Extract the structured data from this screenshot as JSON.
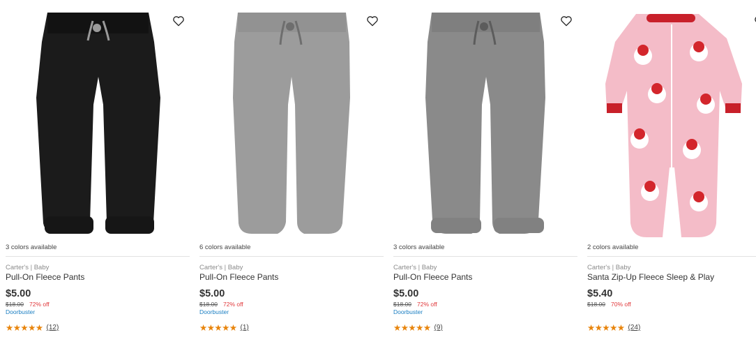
{
  "products": [
    {
      "colors": "3 colors available",
      "brand": "Carter's | Baby",
      "name": "Pull-On Fleece Pants",
      "price": "$5.00",
      "original_price": "$18.00",
      "discount": "72% off",
      "badge": "Doorbuster",
      "stars": "★★★★★",
      "review_count": "(12)",
      "image": "black-fleece-pants",
      "image_color": "#1b1b1b"
    },
    {
      "colors": "6 colors available",
      "brand": "Carter's | Baby",
      "name": "Pull-On Fleece Pants",
      "price": "$5.00",
      "original_price": "$18.00",
      "discount": "72% off",
      "badge": "Doorbuster",
      "stars": "★★★★★",
      "review_count": "(1)",
      "image": "light-gray-fleece-pants",
      "image_color": "#9c9c9c"
    },
    {
      "colors": "3 colors available",
      "brand": "Carter's | Baby",
      "name": "Pull-On Fleece Pants",
      "price": "$5.00",
      "original_price": "$18.00",
      "discount": "72% off",
      "badge": "Doorbuster",
      "stars": "★★★★★",
      "review_count": "(9)",
      "image": "gray-fleece-pants",
      "image_color": "#8a8a8a"
    },
    {
      "colors": "2 colors available",
      "brand": "Carter's | Baby",
      "name": "Santa Zip-Up Fleece Sleep & Play",
      "price": "$5.40",
      "original_price": "$18.00",
      "discount": "70% off",
      "badge": "",
      "stars": "★★★★★",
      "review_count": "(24)",
      "image": "pink-santa-sleeper",
      "image_color": "#f4bcc8"
    }
  ],
  "icons": {
    "wishlist": "heart-outline-icon"
  },
  "colors": {
    "star": "#e8840b",
    "discount": "#e0373a",
    "badge": "#1a7ec2"
  }
}
